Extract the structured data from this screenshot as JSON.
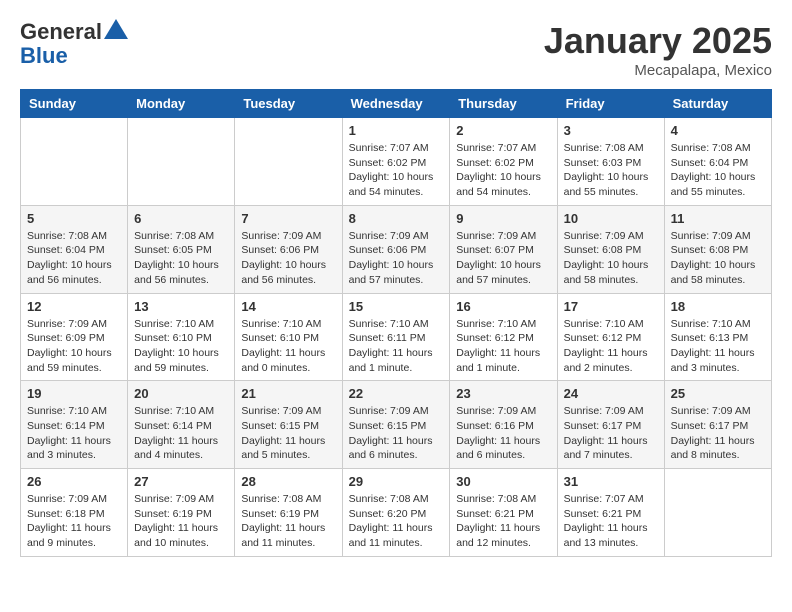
{
  "header": {
    "logo_general": "General",
    "logo_blue": "Blue",
    "month_title": "January 2025",
    "location": "Mecapalapa, Mexico"
  },
  "days_of_week": [
    "Sunday",
    "Monday",
    "Tuesday",
    "Wednesday",
    "Thursday",
    "Friday",
    "Saturday"
  ],
  "weeks": [
    [
      {
        "day": "",
        "info": ""
      },
      {
        "day": "",
        "info": ""
      },
      {
        "day": "",
        "info": ""
      },
      {
        "day": "1",
        "info": "Sunrise: 7:07 AM\nSunset: 6:02 PM\nDaylight: 10 hours\nand 54 minutes."
      },
      {
        "day": "2",
        "info": "Sunrise: 7:07 AM\nSunset: 6:02 PM\nDaylight: 10 hours\nand 54 minutes."
      },
      {
        "day": "3",
        "info": "Sunrise: 7:08 AM\nSunset: 6:03 PM\nDaylight: 10 hours\nand 55 minutes."
      },
      {
        "day": "4",
        "info": "Sunrise: 7:08 AM\nSunset: 6:04 PM\nDaylight: 10 hours\nand 55 minutes."
      }
    ],
    [
      {
        "day": "5",
        "info": "Sunrise: 7:08 AM\nSunset: 6:04 PM\nDaylight: 10 hours\nand 56 minutes."
      },
      {
        "day": "6",
        "info": "Sunrise: 7:08 AM\nSunset: 6:05 PM\nDaylight: 10 hours\nand 56 minutes."
      },
      {
        "day": "7",
        "info": "Sunrise: 7:09 AM\nSunset: 6:06 PM\nDaylight: 10 hours\nand 56 minutes."
      },
      {
        "day": "8",
        "info": "Sunrise: 7:09 AM\nSunset: 6:06 PM\nDaylight: 10 hours\nand 57 minutes."
      },
      {
        "day": "9",
        "info": "Sunrise: 7:09 AM\nSunset: 6:07 PM\nDaylight: 10 hours\nand 57 minutes."
      },
      {
        "day": "10",
        "info": "Sunrise: 7:09 AM\nSunset: 6:08 PM\nDaylight: 10 hours\nand 58 minutes."
      },
      {
        "day": "11",
        "info": "Sunrise: 7:09 AM\nSunset: 6:08 PM\nDaylight: 10 hours\nand 58 minutes."
      }
    ],
    [
      {
        "day": "12",
        "info": "Sunrise: 7:09 AM\nSunset: 6:09 PM\nDaylight: 10 hours\nand 59 minutes."
      },
      {
        "day": "13",
        "info": "Sunrise: 7:10 AM\nSunset: 6:10 PM\nDaylight: 10 hours\nand 59 minutes."
      },
      {
        "day": "14",
        "info": "Sunrise: 7:10 AM\nSunset: 6:10 PM\nDaylight: 11 hours\nand 0 minutes."
      },
      {
        "day": "15",
        "info": "Sunrise: 7:10 AM\nSunset: 6:11 PM\nDaylight: 11 hours\nand 1 minute."
      },
      {
        "day": "16",
        "info": "Sunrise: 7:10 AM\nSunset: 6:12 PM\nDaylight: 11 hours\nand 1 minute."
      },
      {
        "day": "17",
        "info": "Sunrise: 7:10 AM\nSunset: 6:12 PM\nDaylight: 11 hours\nand 2 minutes."
      },
      {
        "day": "18",
        "info": "Sunrise: 7:10 AM\nSunset: 6:13 PM\nDaylight: 11 hours\nand 3 minutes."
      }
    ],
    [
      {
        "day": "19",
        "info": "Sunrise: 7:10 AM\nSunset: 6:14 PM\nDaylight: 11 hours\nand 3 minutes."
      },
      {
        "day": "20",
        "info": "Sunrise: 7:10 AM\nSunset: 6:14 PM\nDaylight: 11 hours\nand 4 minutes."
      },
      {
        "day": "21",
        "info": "Sunrise: 7:09 AM\nSunset: 6:15 PM\nDaylight: 11 hours\nand 5 minutes."
      },
      {
        "day": "22",
        "info": "Sunrise: 7:09 AM\nSunset: 6:15 PM\nDaylight: 11 hours\nand 6 minutes."
      },
      {
        "day": "23",
        "info": "Sunrise: 7:09 AM\nSunset: 6:16 PM\nDaylight: 11 hours\nand 6 minutes."
      },
      {
        "day": "24",
        "info": "Sunrise: 7:09 AM\nSunset: 6:17 PM\nDaylight: 11 hours\nand 7 minutes."
      },
      {
        "day": "25",
        "info": "Sunrise: 7:09 AM\nSunset: 6:17 PM\nDaylight: 11 hours\nand 8 minutes."
      }
    ],
    [
      {
        "day": "26",
        "info": "Sunrise: 7:09 AM\nSunset: 6:18 PM\nDaylight: 11 hours\nand 9 minutes."
      },
      {
        "day": "27",
        "info": "Sunrise: 7:09 AM\nSunset: 6:19 PM\nDaylight: 11 hours\nand 10 minutes."
      },
      {
        "day": "28",
        "info": "Sunrise: 7:08 AM\nSunset: 6:19 PM\nDaylight: 11 hours\nand 11 minutes."
      },
      {
        "day": "29",
        "info": "Sunrise: 7:08 AM\nSunset: 6:20 PM\nDaylight: 11 hours\nand 11 minutes."
      },
      {
        "day": "30",
        "info": "Sunrise: 7:08 AM\nSunset: 6:21 PM\nDaylight: 11 hours\nand 12 minutes."
      },
      {
        "day": "31",
        "info": "Sunrise: 7:07 AM\nSunset: 6:21 PM\nDaylight: 11 hours\nand 13 minutes."
      },
      {
        "day": "",
        "info": ""
      }
    ]
  ]
}
